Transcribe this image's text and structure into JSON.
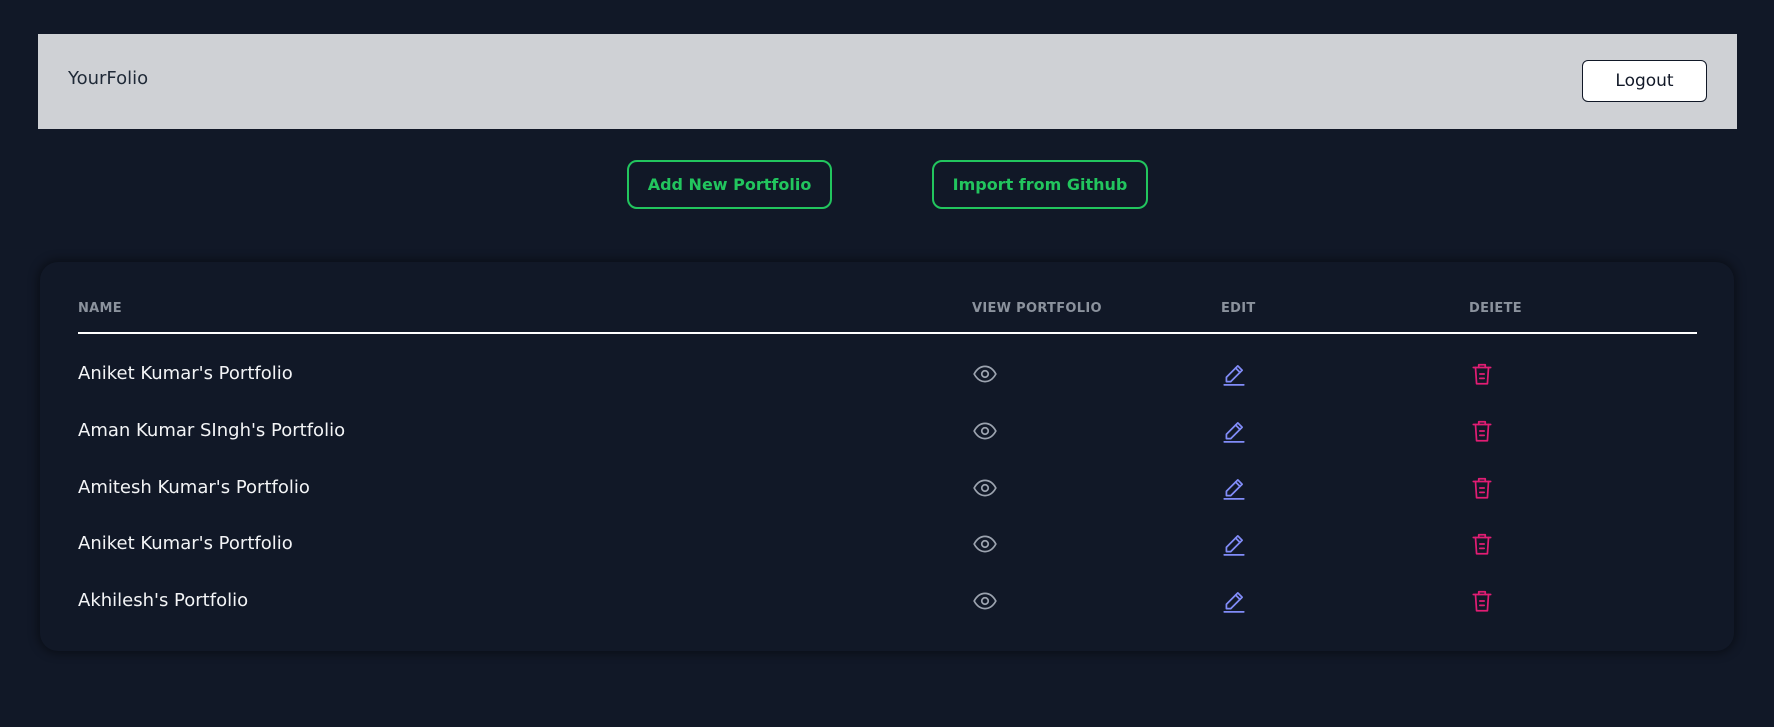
{
  "navbar": {
    "brand": "YourFolio",
    "logout_label": "Logout"
  },
  "actions": {
    "add_label": "Add New Portfolio",
    "import_label": "Import from Github"
  },
  "table": {
    "columns": [
      "NAME",
      "VIEW PORTFOLIO",
      "EDIT",
      "DEIETE"
    ],
    "rows": [
      {
        "name": "Aniket Kumar's Portfolio"
      },
      {
        "name": "Aman Kumar SIngh's Portfolio"
      },
      {
        "name": "Amitesh Kumar's Portfolio"
      },
      {
        "name": "Aniket Kumar's Portfolio"
      },
      {
        "name": "Akhilesh's Portfolio"
      }
    ]
  },
  "icons": {
    "view": "eye-icon",
    "edit": "pencil-icon",
    "delete": "trash-icon"
  },
  "colors": {
    "background": "#111827",
    "navbar": "#cfd1d5",
    "accent_green": "#22c55e",
    "edit_icon": "#818cf8",
    "delete_icon": "#e11d74",
    "view_icon": "#9ca3af"
  }
}
